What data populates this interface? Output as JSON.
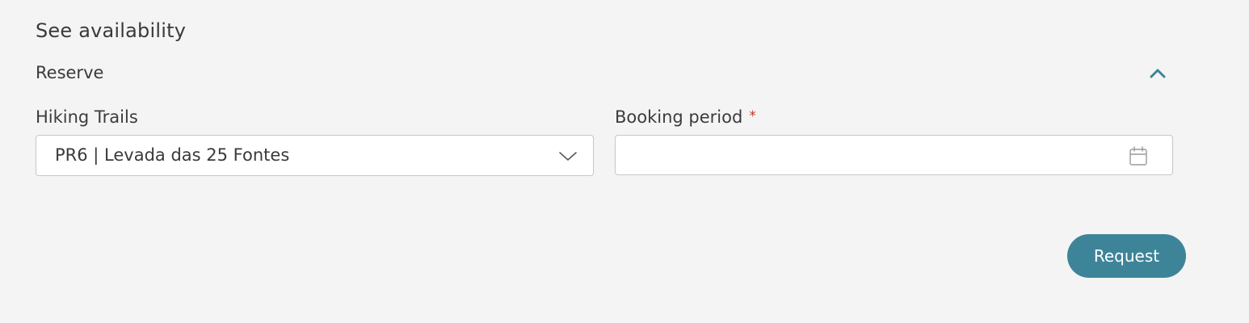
{
  "page": {
    "heading": "See availability"
  },
  "reserve": {
    "title": "Reserve",
    "toggle_icon": "chevron-up-icon",
    "expanded": true
  },
  "trail_select": {
    "label": "Hiking Trails",
    "value": "PR6 | Levada das 25 Fontes",
    "icon": "chevron-down-icon"
  },
  "booking_period": {
    "label": "Booking period",
    "required_marker": "*",
    "value": "",
    "icon": "calendar-icon"
  },
  "actions": {
    "request_label": "Request"
  },
  "colors": {
    "background": "#f4f4f4",
    "accent": "#3e8499",
    "required": "#c0392b",
    "border": "#c7c7c7",
    "text": "#3a3a3a"
  }
}
